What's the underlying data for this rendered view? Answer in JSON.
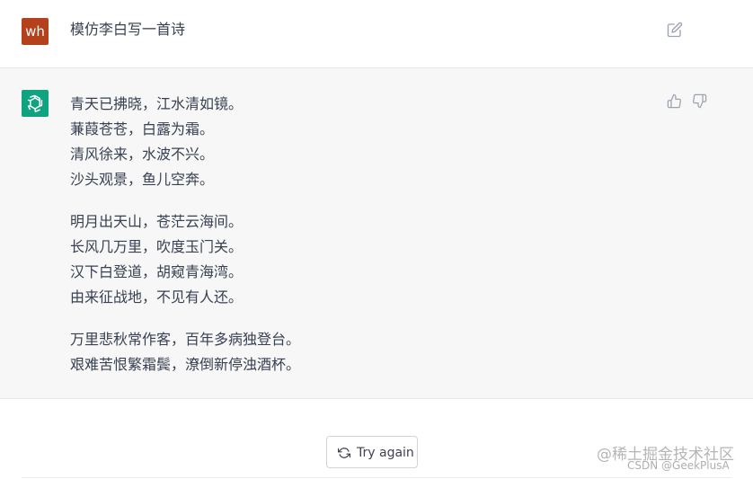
{
  "user_message": {
    "avatar_text": "wh",
    "text": "模仿李白写一首诗"
  },
  "assistant_message": {
    "stanzas": [
      [
        "青天已拂晓，江水清如镜。",
        "蒹葭苍苍，白露为霜。",
        "清风徐来，水波不兴。",
        "沙头观景，鱼儿空奔。"
      ],
      [
        "明月出天山，苍茫云海间。",
        "长风几万里，吹度玉门关。",
        "汉下白登道，胡窥青海湾。",
        "由来征战地，不见有人还。"
      ],
      [
        "万里悲秋常作客，百年多病独登台。",
        "艰难苦恨繁霜鬓，潦倒新停浊酒杯。"
      ]
    ]
  },
  "actions": {
    "try_again_label": "Try again"
  },
  "watermark": {
    "line1": "@稀土掘金技术社区",
    "line2": "CSDN @GeekPlusA"
  },
  "colors": {
    "user_avatar": "#b5401c",
    "bot_avatar": "#10a37f",
    "assistant_bg": "#f7f7f8"
  },
  "icons": [
    "edit-icon",
    "openai-logo-icon",
    "thumbs-up-icon",
    "thumbs-down-icon",
    "refresh-icon"
  ]
}
